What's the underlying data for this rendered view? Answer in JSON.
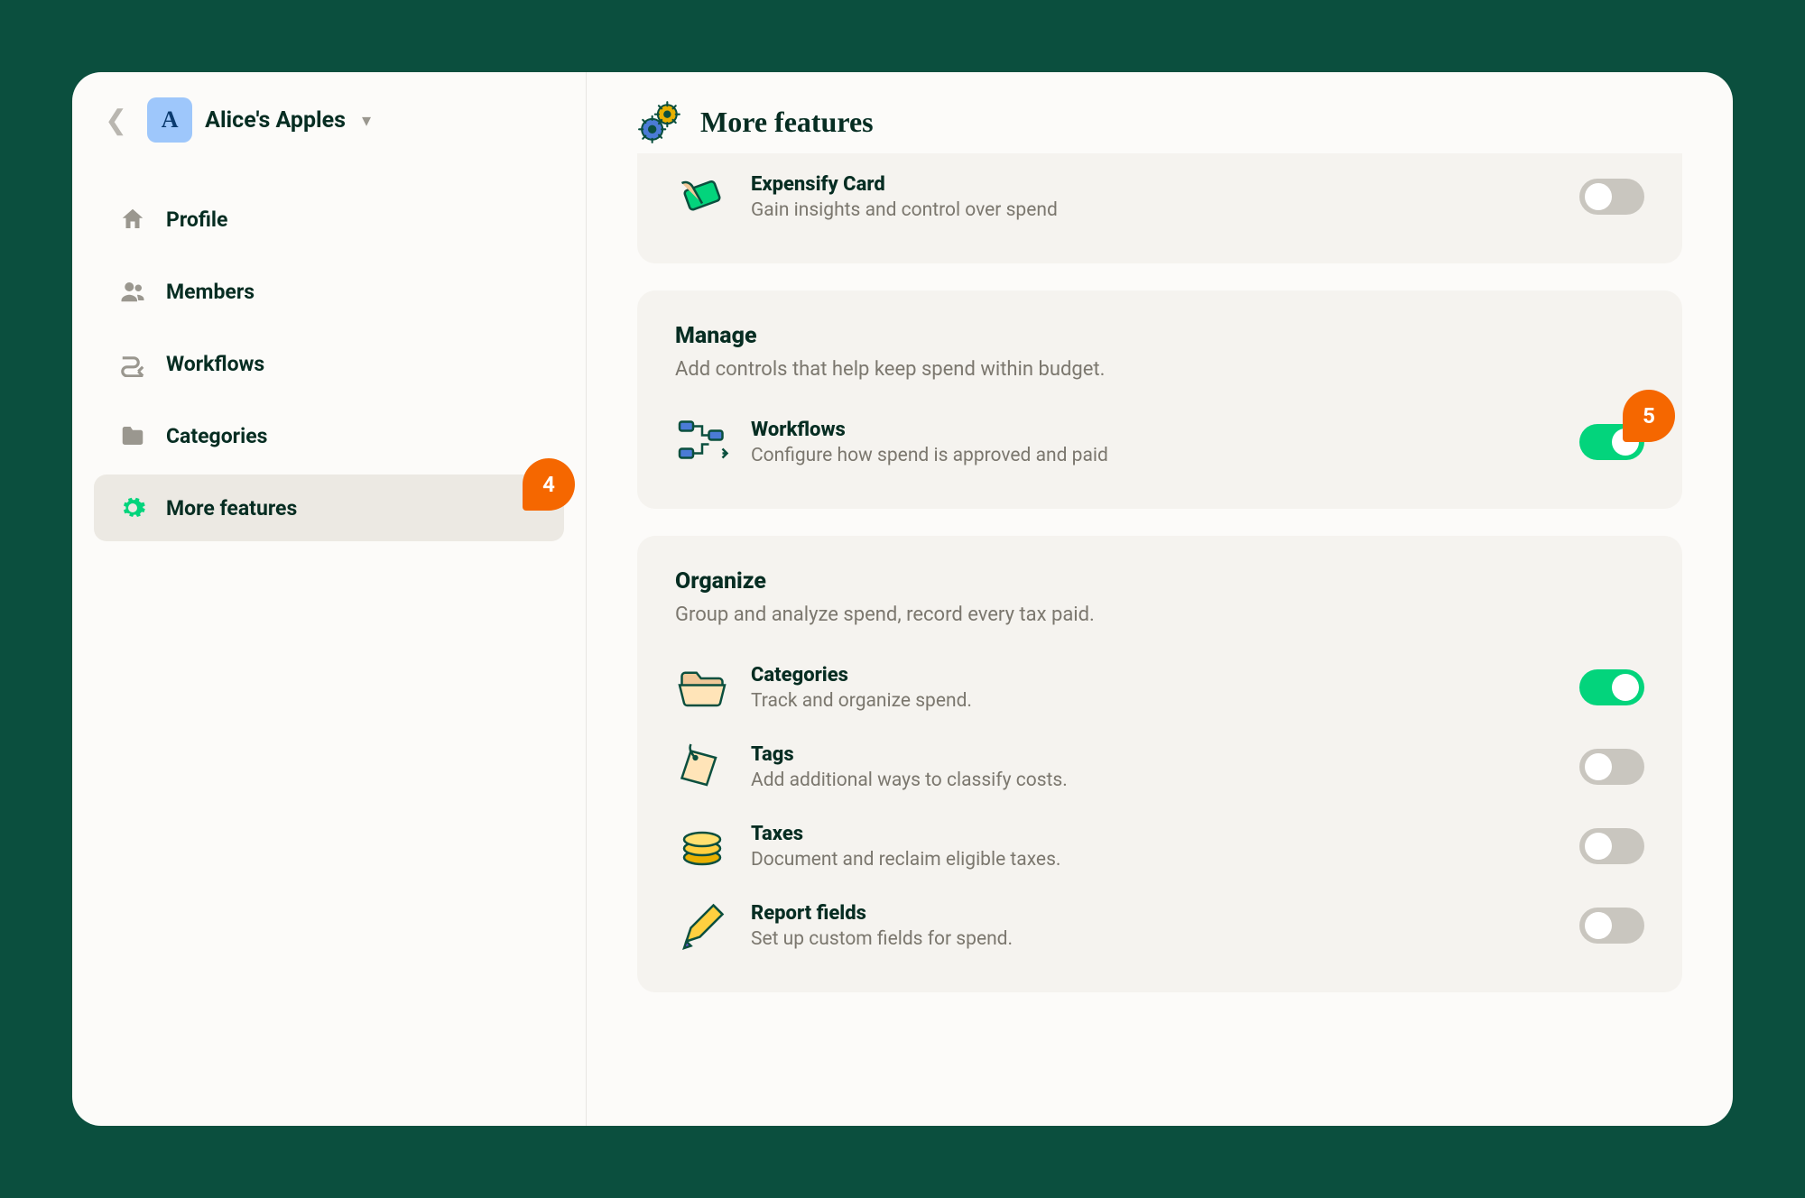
{
  "workspace": {
    "avatar_letter": "A",
    "name": "Alice's Apples"
  },
  "sidebar": {
    "items": [
      {
        "label": "Profile"
      },
      {
        "label": "Members"
      },
      {
        "label": "Workflows"
      },
      {
        "label": "Categories"
      },
      {
        "label": "More features"
      }
    ]
  },
  "callouts": {
    "four": "4",
    "five": "5"
  },
  "header": {
    "title": "More features"
  },
  "sections": {
    "spend": {
      "items": [
        {
          "name": "Expensify Card",
          "desc": "Gain insights and control over spend",
          "enabled": false
        }
      ]
    },
    "manage": {
      "title": "Manage",
      "sub": "Add controls that help keep spend within budget.",
      "items": [
        {
          "name": "Workflows",
          "desc": "Configure how spend is approved and paid",
          "enabled": true
        }
      ]
    },
    "organize": {
      "title": "Organize",
      "sub": "Group and analyze spend, record every tax paid.",
      "items": [
        {
          "name": "Categories",
          "desc": "Track and organize spend.",
          "enabled": true
        },
        {
          "name": "Tags",
          "desc": "Add additional ways to classify costs.",
          "enabled": false
        },
        {
          "name": "Taxes",
          "desc": "Document and reclaim eligible taxes.",
          "enabled": false
        },
        {
          "name": "Report fields",
          "desc": "Set up custom fields for spend.",
          "enabled": false
        }
      ]
    }
  }
}
